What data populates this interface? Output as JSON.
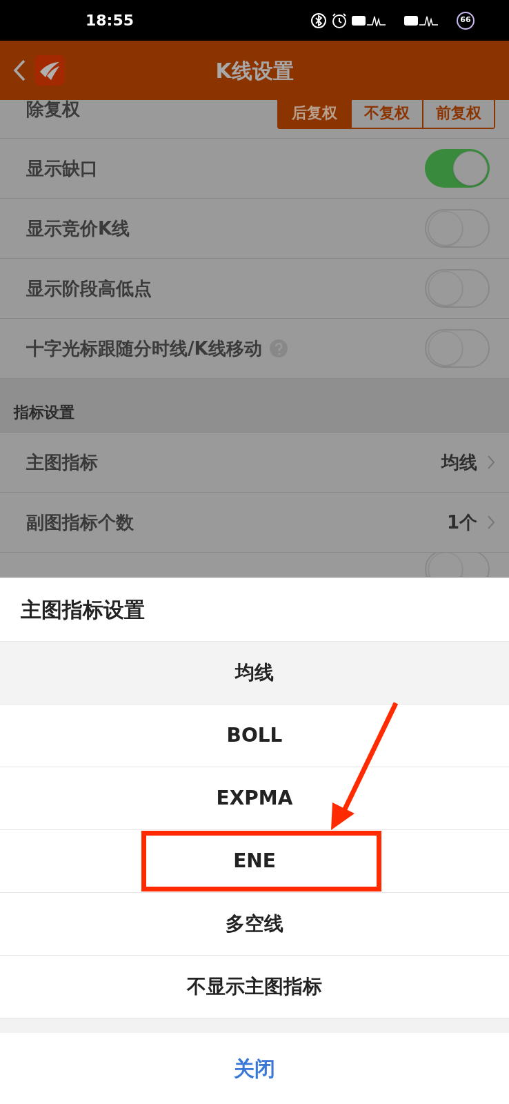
{
  "status_bar": {
    "time": "18:55",
    "battery": "66"
  },
  "header": {
    "title": "K线设置"
  },
  "settings": [
    {
      "kind": "segment",
      "label": "除复权",
      "options": [
        {
          "label": "后复权",
          "selected": true
        },
        {
          "label": "不复权",
          "selected": false
        },
        {
          "label": "前复权",
          "selected": false
        }
      ]
    },
    {
      "kind": "toggle",
      "label": "显示缺口",
      "on": true
    },
    {
      "kind": "toggle",
      "label": "显示竞价K线",
      "on": false
    },
    {
      "kind": "toggle",
      "label": "显示阶段高低点",
      "on": false
    },
    {
      "kind": "toggle",
      "label": "十字光标跟随分时线/K线移动",
      "on": false,
      "help": true
    },
    {
      "kind": "section",
      "label": "指标设置"
    },
    {
      "kind": "link",
      "label": "主图指标",
      "value": "均线"
    },
    {
      "kind": "link",
      "label": "副图指标个数",
      "value": "1个"
    },
    {
      "kind": "toggle",
      "on": false
    }
  ],
  "sheet": {
    "title": "主图指标设置",
    "options": [
      {
        "label": "均线",
        "selected": true,
        "highlighted": false
      },
      {
        "label": "BOLL",
        "selected": false,
        "highlighted": false
      },
      {
        "label": "EXPMA",
        "selected": false,
        "highlighted": false
      },
      {
        "label": "ENE",
        "selected": false,
        "highlighted": true
      },
      {
        "label": "多空线",
        "selected": false,
        "highlighted": false
      },
      {
        "label": "不显示主图指标",
        "selected": false,
        "highlighted": false
      }
    ],
    "close": "关闭"
  }
}
